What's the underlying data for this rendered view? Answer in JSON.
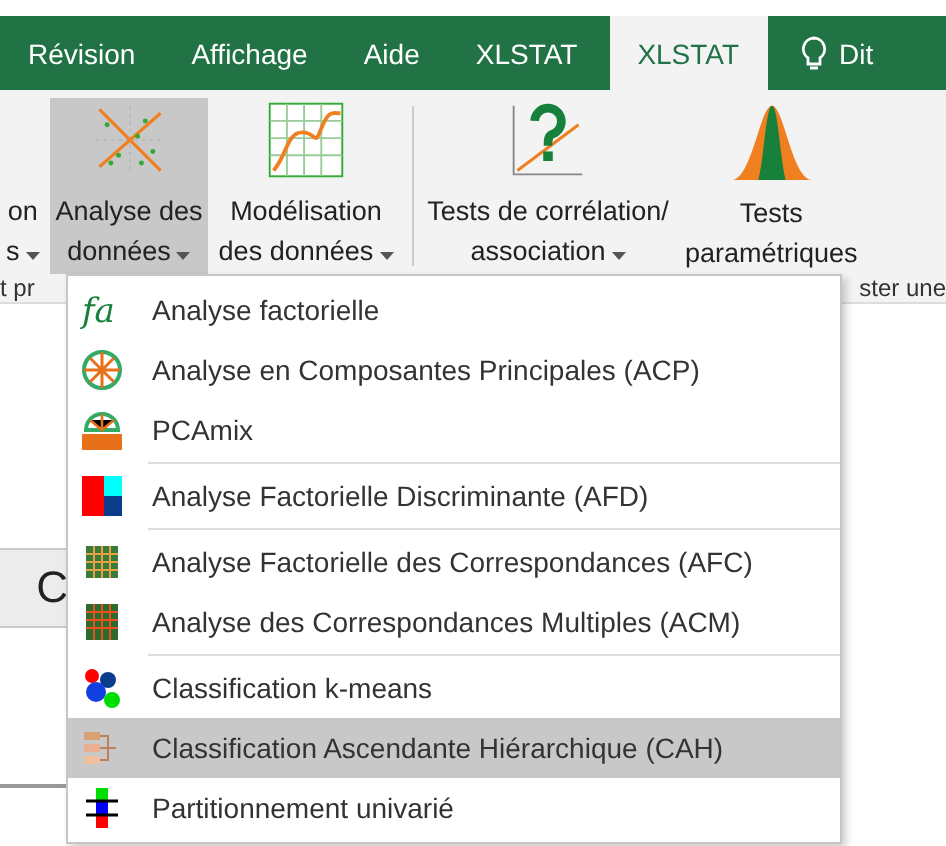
{
  "tabs": [
    {
      "label": "Révision",
      "selected": false,
      "kind": "text"
    },
    {
      "label": "Affichage",
      "selected": false,
      "kind": "text"
    },
    {
      "label": "Aide",
      "selected": false,
      "kind": "text"
    },
    {
      "label": "XLSTAT",
      "selected": false,
      "kind": "text"
    },
    {
      "label": "XLSTAT",
      "selected": true,
      "kind": "text"
    },
    {
      "label": "Dit",
      "selected": false,
      "kind": "lightbulb"
    }
  ],
  "ribbon": {
    "buttons": [
      {
        "lines": [
          "on",
          "s"
        ],
        "caret": true,
        "selected": false
      },
      {
        "lines": [
          "Analyse des",
          "données"
        ],
        "caret": true,
        "selected": true
      },
      {
        "lines": [
          "Modélisation",
          "des données"
        ],
        "caret": true,
        "selected": false
      },
      {
        "lines": [
          "Tests de corrélation/",
          "association"
        ],
        "caret": true,
        "selected": false
      },
      {
        "lines": [
          "Tests",
          "paramétriques"
        ],
        "caret": false,
        "selected": false
      }
    ],
    "group_labels": [
      "t pr",
      "ster une"
    ]
  },
  "sheet": {
    "cell_text": "C"
  },
  "menu": {
    "items": [
      {
        "label": "Analyse factorielle",
        "icon_text": "fa",
        "selected": false,
        "separator_after": false
      },
      {
        "label": "Analyse en Composantes Principales (ACP)",
        "selected": false,
        "separator_after": false
      },
      {
        "label": "PCAmix",
        "selected": false,
        "separator_after": true
      },
      {
        "label": "Analyse Factorielle Discriminante (AFD)",
        "selected": false,
        "separator_after": true
      },
      {
        "label": "Analyse Factorielle des Correspondances (AFC)",
        "selected": false,
        "separator_after": false
      },
      {
        "label": "Analyse des Correspondances Multiples (ACM)",
        "selected": false,
        "separator_after": true
      },
      {
        "label": "Classification k-means",
        "selected": false,
        "separator_after": false
      },
      {
        "label": "Classification Ascendante Hiérarchique (CAH)",
        "selected": true,
        "separator_after": false
      },
      {
        "label": "Partitionnement univarié",
        "selected": false,
        "separator_after": false
      }
    ]
  }
}
